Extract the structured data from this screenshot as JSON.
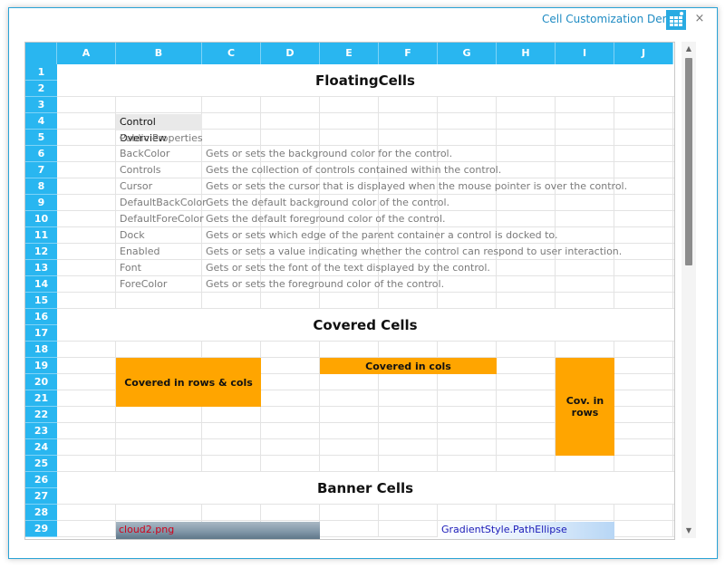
{
  "window": {
    "title": "Cell Customization Demo",
    "icon": "grid-app-icon",
    "close_glyph": "×"
  },
  "columns": [
    "A",
    "B",
    "C",
    "D",
    "E",
    "F",
    "G",
    "H",
    "I",
    "J"
  ],
  "rows": [
    "1",
    "2",
    "3",
    "4",
    "5",
    "6",
    "7",
    "8",
    "9",
    "10",
    "11",
    "12",
    "13",
    "14",
    "15",
    "16",
    "17",
    "18",
    "19",
    "20",
    "21",
    "22",
    "23",
    "24",
    "25",
    "26",
    "27",
    "28",
    "29"
  ],
  "floating": {
    "heading": "FloatingCells",
    "control_overview": "Control Overview",
    "public_properties": "Public Properties",
    "properties": [
      {
        "name": "BackColor",
        "desc": "Gets or sets the background color for the control."
      },
      {
        "name": "Controls",
        "desc": "Gets the collection of controls contained within the control."
      },
      {
        "name": "Cursor",
        "desc": "Gets or sets the cursor that is displayed when the mouse pointer is over the control."
      },
      {
        "name": "DefaultBackColor",
        "desc": "Gets the default background color of the control."
      },
      {
        "name": "DefaultForeColor",
        "desc": "Gets the default foreground color of the control."
      },
      {
        "name": "Dock",
        "desc": "Gets or sets which edge of the parent container a control is docked to."
      },
      {
        "name": "Enabled",
        "desc": "Gets or sets a value indicating whether the control can respond to user interaction."
      },
      {
        "name": "Font",
        "desc": "Gets or sets the font of the text displayed by the control."
      },
      {
        "name": "ForeColor",
        "desc": "Gets or sets the foreground color of the control."
      }
    ]
  },
  "covered": {
    "heading": "Covered Cells",
    "rows_cols": "Covered in rows & cols",
    "cols": "Covered in cols",
    "rows_line1": "Cov. in",
    "rows_line2": "rows"
  },
  "banner": {
    "heading": "Banner Cells",
    "image_label": "cloud2.png",
    "gradient_label": "GradientStyle.PathEllipse"
  },
  "colors": {
    "header_blue": "#29b6f0",
    "covered_orange": "#ffa500",
    "title_blue": "#1e8bc3",
    "image_label_red": "#d0021b",
    "gradient_label_blue": "#1a1ab8"
  }
}
